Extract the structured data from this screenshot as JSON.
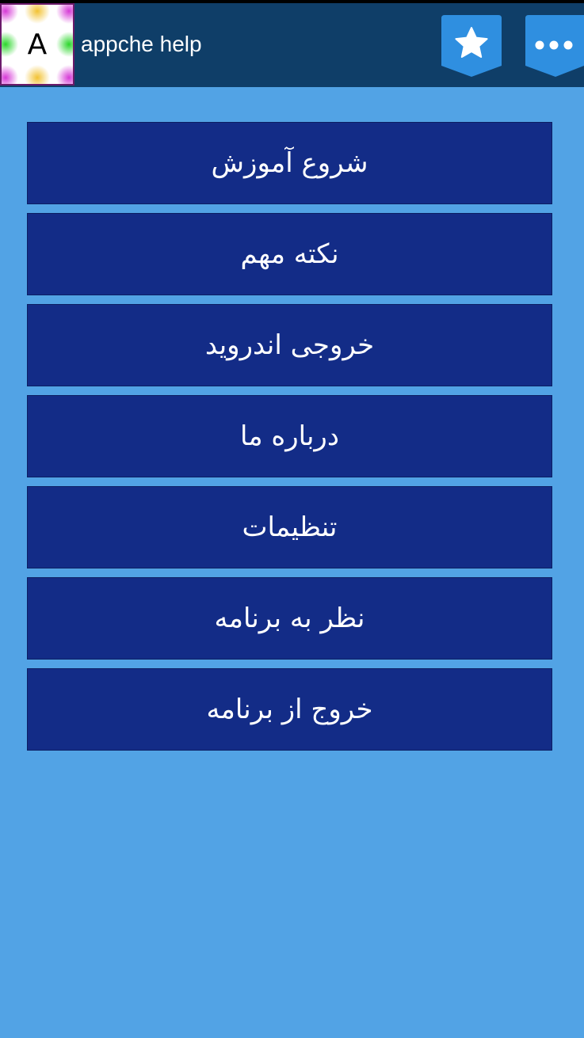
{
  "colors": {
    "background": "#52a3e5",
    "app_bar": "#0f3e68",
    "menu_item": "#132c87",
    "action_shield": "#2f8fe0"
  },
  "app_bar": {
    "logo_letter": "A",
    "title": "appche help",
    "favorite_icon": "star-icon",
    "more_icon": "more-dots-icon"
  },
  "menu": {
    "items": [
      {
        "label": "شروع آموزش"
      },
      {
        "label": "نکته مهم"
      },
      {
        "label": "خروجی اندروید"
      },
      {
        "label": "درباره ما"
      },
      {
        "label": "تنظیمات"
      },
      {
        "label": "نظر به برنامه"
      },
      {
        "label": "خروج از برنامه"
      }
    ]
  }
}
